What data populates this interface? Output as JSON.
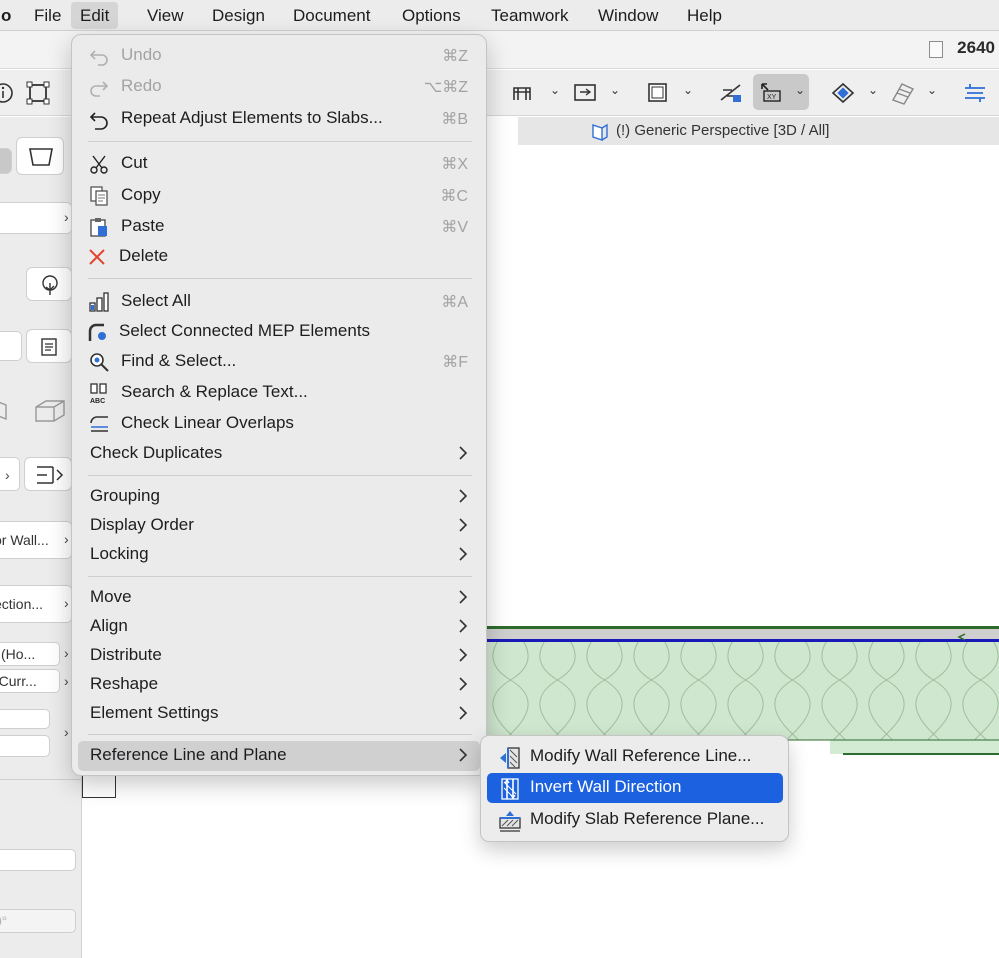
{
  "menubar": {
    "app_fragment": "o",
    "items": [
      "File",
      "Edit",
      "View",
      "Design",
      "Document",
      "Options",
      "Teamwork",
      "Window",
      "Help"
    ]
  },
  "header": {
    "counter": "2640"
  },
  "view_tab": {
    "label": "(!) Generic Perspective [3D / All]"
  },
  "left_panel": {
    "fields": [
      "or Wall...",
      "ection...",
      "l (Ho...",
      "(Curr...",
      "0°"
    ]
  },
  "edit_menu": {
    "groups": [
      [
        {
          "label": "Undo",
          "shortcut": "⌘Z",
          "icon": "undo-icon",
          "disabled": true
        },
        {
          "label": "Redo",
          "shortcut": "⌥⌘Z",
          "icon": "redo-icon",
          "disabled": true
        },
        {
          "label": "Repeat Adjust Elements to Slabs...",
          "shortcut": "⌘B",
          "icon": "repeat-icon"
        }
      ],
      [
        {
          "label": "Cut",
          "shortcut": "⌘X",
          "icon": "scissors-icon"
        },
        {
          "label": "Copy",
          "shortcut": "⌘C",
          "icon": "copy-icon"
        },
        {
          "label": "Paste",
          "shortcut": "⌘V",
          "icon": "clipboard-icon"
        },
        {
          "label": "Delete",
          "icon": "delete-x-icon"
        }
      ],
      [
        {
          "label": "Select All",
          "shortcut": "⌘A",
          "icon": "select-all-icon"
        },
        {
          "label": "Select Connected MEP Elements",
          "icon": "mep-connect-icon"
        },
        {
          "label": "Find & Select...",
          "shortcut": "⌘F",
          "icon": "find-select-icon"
        },
        {
          "label": "Search & Replace Text...",
          "icon": "binoculars-abc-icon"
        },
        {
          "label": "Check Linear Overlaps",
          "icon": "linear-overlap-icon"
        },
        {
          "label": "Check Duplicates",
          "submenu": true
        }
      ],
      [
        {
          "label": "Grouping",
          "submenu": true
        },
        {
          "label": "Display Order",
          "submenu": true
        },
        {
          "label": "Locking",
          "submenu": true
        }
      ],
      [
        {
          "label": "Move",
          "submenu": true
        },
        {
          "label": "Align",
          "submenu": true
        },
        {
          "label": "Distribute",
          "submenu": true
        },
        {
          "label": "Reshape",
          "submenu": true
        },
        {
          "label": "Element Settings",
          "submenu": true
        }
      ],
      [
        {
          "label": "Reference Line and Plane",
          "submenu": true,
          "highlighted": true
        }
      ]
    ]
  },
  "submenu": {
    "items": [
      {
        "label": "Modify Wall Reference Line...",
        "icon": "wall-reference-line-icon"
      },
      {
        "label": "Invert Wall Direction",
        "icon": "invert-wall-direction-icon",
        "selected": true
      },
      {
        "label": "Modify Slab Reference Plane...",
        "icon": "slab-reference-plane-icon"
      }
    ]
  },
  "colors": {
    "accent_selection": "#1b61e0",
    "delete_red": "#e0442f",
    "insulation_fill": "#cfe6cf",
    "wall_reference_blue": "#1a1ab8",
    "wall_outline_green": "#2e6b2e"
  }
}
